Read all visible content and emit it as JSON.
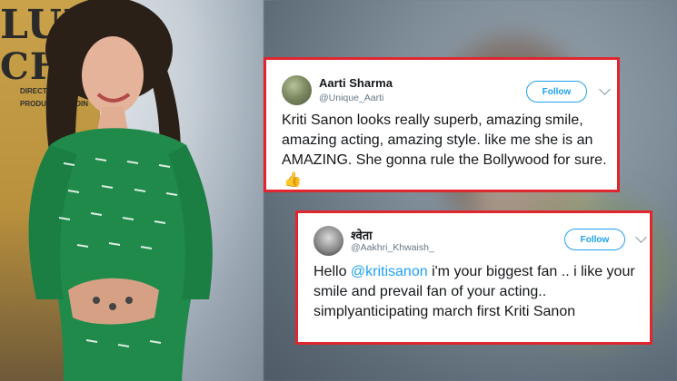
{
  "background": {
    "poster_text": [
      "LUKA",
      "CHUP"
    ],
    "poster_credits": [
      "DIRECTED BY LAXM",
      "PRODUCED BY DIN"
    ]
  },
  "tweets": [
    {
      "name": "Aarti Sharma",
      "handle": "@Unique_Aarti",
      "follow_label": "Follow",
      "text": "Kriti Sanon looks really superb, amazing smile, amazing acting, amazing style. like me she is an AMAZING. She gonna rule the Bollywood for sure.",
      "emoji_icon": "thumbs-up"
    },
    {
      "name": "श्वेता",
      "handle": "@Aakhri_Khwaish_",
      "follow_label": "Follow",
      "text_prefix": "Hello ",
      "mention": "@kritisanon",
      "text_suffix": " i'm your biggest fan .. i like your smile and prevail fan of your acting.. simplyanticipating march first Kriti Sanon"
    }
  ],
  "colors": {
    "highlight_border": "#e0262e",
    "twitter_blue": "#1da1f2",
    "text_primary": "#14171a",
    "text_secondary": "#657786"
  }
}
